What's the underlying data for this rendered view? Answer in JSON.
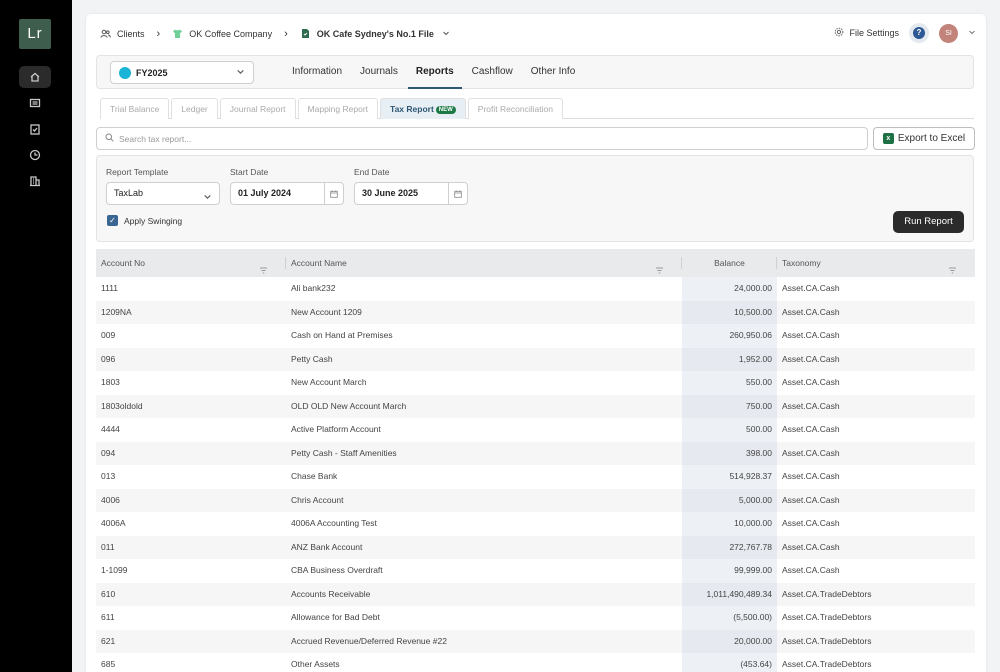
{
  "app": {
    "logo_text": "Lr"
  },
  "breadcrumb": {
    "clients": "Clients",
    "company": "OK Coffee Company",
    "file": "OK Cafe Sydney's No.1 File"
  },
  "header": {
    "file_settings": "File Settings",
    "help": "?",
    "avatar_initials": "SI"
  },
  "fy_select": {
    "value": "FY2025"
  },
  "top_tabs": [
    "Information",
    "Journals",
    "Reports",
    "Cashflow",
    "Other Info"
  ],
  "active_top_tab": "Reports",
  "sub_tabs": [
    "Trial Balance",
    "Ledger",
    "Journal Report",
    "Mapping Report",
    "Tax Report",
    "Profit Reconciliation"
  ],
  "active_sub_tab": "Tax Report",
  "new_badge": "NEW",
  "search": {
    "placeholder": "Search tax report..."
  },
  "export_label": "Export to Excel",
  "filters": {
    "template_label": "Report Template",
    "template_value": "TaxLab",
    "start_label": "Start Date",
    "start_value": "01 July 2024",
    "end_label": "End Date",
    "end_value": "30 June 2025",
    "swinging_label": "Apply Swinging",
    "swinging_checked": true,
    "run_label": "Run Report"
  },
  "table": {
    "columns": [
      "Account No",
      "Account Name",
      "Balance",
      "Taxonomy"
    ],
    "rows": [
      [
        "1111",
        "Ali bank232",
        "24,000.00",
        "Asset.CA.Cash"
      ],
      [
        "1209NA",
        "New Account 1209",
        "10,500.00",
        "Asset.CA.Cash"
      ],
      [
        "009",
        "Cash on Hand at Premises",
        "260,950.06",
        "Asset.CA.Cash"
      ],
      [
        "096",
        "Petty Cash",
        "1,952.00",
        "Asset.CA.Cash"
      ],
      [
        "1803",
        "New Account March",
        "550.00",
        "Asset.CA.Cash"
      ],
      [
        "1803oldold",
        "OLD OLD New Account March",
        "750.00",
        "Asset.CA.Cash"
      ],
      [
        "4444",
        "Active Platform Account",
        "500.00",
        "Asset.CA.Cash"
      ],
      [
        "094",
        "Petty Cash - Staff Amenities",
        "398.00",
        "Asset.CA.Cash"
      ],
      [
        "013",
        "Chase Bank",
        "514,928.37",
        "Asset.CA.Cash"
      ],
      [
        "4006",
        "Chris Account",
        "5,000.00",
        "Asset.CA.Cash"
      ],
      [
        "4006A",
        "4006A Accounting Test",
        "10,000.00",
        "Asset.CA.Cash"
      ],
      [
        "011",
        "ANZ Bank Account",
        "272,767.78",
        "Asset.CA.Cash"
      ],
      [
        "1-1099",
        "CBA Business Overdraft",
        "99,999.00",
        "Asset.CA.Cash"
      ],
      [
        "610",
        "Accounts Receivable",
        "1,011,490,489.34",
        "Asset.CA.TradeDebtors"
      ],
      [
        "611",
        "Allowance for Bad Debt",
        "(5,500.00)",
        "Asset.CA.TradeDebtors"
      ],
      [
        "621",
        "Accrued Revenue/Deferred Revenue #22",
        "20,000.00",
        "Asset.CA.TradeDebtors"
      ],
      [
        "685",
        "Other Assets",
        "(453.64)",
        "Asset.CA.TradeDebtors"
      ]
    ]
  }
}
